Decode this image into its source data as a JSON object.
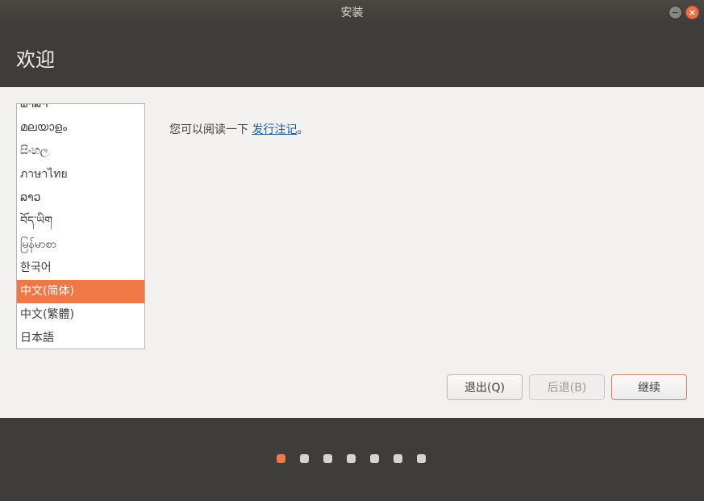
{
  "window": {
    "title": "安装",
    "minimize_icon": "−",
    "close_icon": "×"
  },
  "header": {
    "title": "欢迎"
  },
  "languages": [
    "ພາສາ",
    "മലയാളം",
    "සිංහල",
    "ภาษาไทย",
    "ລາວ",
    "བོད་ཡིག",
    "မြန်မာစာ",
    "한국어",
    "中文(简体)",
    "中文(繁體)",
    "日本語"
  ],
  "selected_language_index": 8,
  "release_notes": {
    "prefix": "您可以阅读一下 ",
    "link": "发行注记",
    "suffix": "。"
  },
  "buttons": {
    "quit": "退出(Q)",
    "back": "后退(B)",
    "continue": "继续"
  },
  "progress": {
    "total_steps": 7,
    "current_step": 1
  },
  "colors": {
    "accent": "#f07746",
    "header_bg": "#3f3d39",
    "link": "#19609c"
  }
}
